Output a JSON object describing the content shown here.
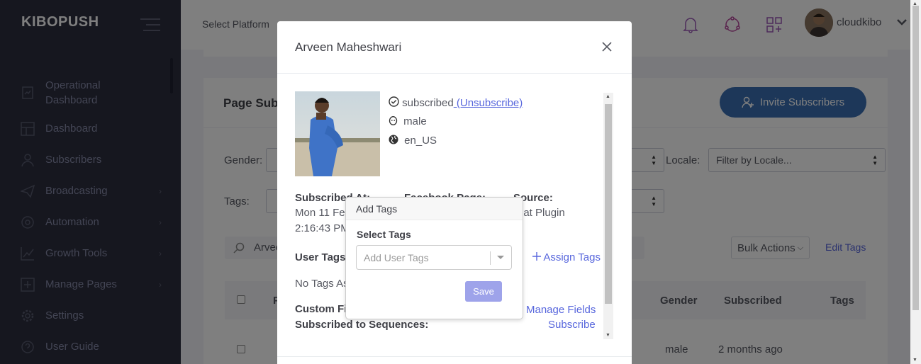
{
  "app": {
    "brand": "KIBOPUSH"
  },
  "sidebar": {
    "items": [
      {
        "label": "Operational Dashboard",
        "icon": "dashboard-doc-icon",
        "has_arrow": false
      },
      {
        "label": "Dashboard",
        "icon": "dashboard-icon",
        "has_arrow": false
      },
      {
        "label": "Subscribers",
        "icon": "subscribers-icon",
        "has_arrow": false
      },
      {
        "label": "Broadcasting",
        "icon": "paper-plane-icon",
        "has_arrow": true
      },
      {
        "label": "Automation",
        "icon": "automation-icon",
        "has_arrow": true
      },
      {
        "label": "Growth Tools",
        "icon": "growth-chart-icon",
        "has_arrow": true
      },
      {
        "label": "Manage Pages",
        "icon": "manage-pages-icon",
        "has_arrow": true
      },
      {
        "label": "Settings",
        "icon": "gear-icon",
        "has_arrow": false
      },
      {
        "label": "User Guide",
        "icon": "question-icon",
        "has_arrow": false
      }
    ]
  },
  "header": {
    "select_platform": "Select Platform",
    "username": "cloudkibo"
  },
  "page": {
    "title": "Page Sub",
    "invite_button": "Invite Subscribers",
    "gender_label": "Gender:",
    "locale_label": "Locale:",
    "locale_placeholder": "Filter by Locale...",
    "tags_label": "Tags:",
    "search_value": "Arvee",
    "bulk_actions": "Bulk Actions",
    "edit_tags": "Edit Tags",
    "table": {
      "headers": [
        "P",
        "Gender",
        "Subscribed",
        "Tags"
      ],
      "row": {
        "gender": "male",
        "subscribed": "2 months ago"
      }
    }
  },
  "modal": {
    "title": "Arveen Maheshwari",
    "status": "subscribed",
    "unsubscribe_link": " (Unsubscribe)",
    "gender": "male",
    "locale": "en_US",
    "subscribed_at_label": "Subscribed At:",
    "subscribed_at_date": "Mon 11 Feb",
    "subscribed_at_time": "2:16:43 PM",
    "facebook_page_label": "Facebook Page:",
    "source_label": "Source:",
    "source_value": "hat Plugin",
    "user_tags_label": "User Tags:",
    "assign_tags": "Assign Tags",
    "no_tags": "No Tags As",
    "custom_fields_label": "Custom Fi",
    "manage_fields": "Manage Fields",
    "sequences_label": "Subscribed to Sequences:",
    "subscribe_link": "Subscribe"
  },
  "popover": {
    "title": "Add Tags",
    "select_label": "Select Tags",
    "placeholder": "Add User Tags",
    "save": "Save"
  },
  "colors": {
    "sidebar_bg": "#2c2e3e",
    "brand_blue": "#3b6fb2",
    "link": "#5867dd",
    "save_button": "#9ea3ea"
  }
}
